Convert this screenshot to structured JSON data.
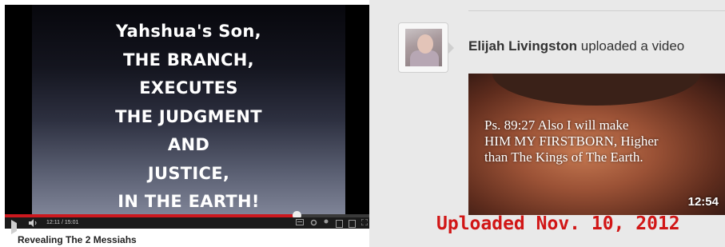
{
  "player": {
    "slide_lines": [
      "Yahshua's Son,",
      "THE BRANCH,",
      "EXECUTES",
      "THE JUDGMENT",
      "AND",
      "JUSTICE,",
      "IN THE EARTH!"
    ],
    "progress_fraction": 0.8,
    "time_display": "12:11 / 15:01",
    "video_title": "Revealing The 2 Messiahs"
  },
  "feed": {
    "user_name": "Elijah Livingston",
    "action_text": " uploaded a video",
    "thumbnail_quote_lines": [
      "Ps. 89:27 Also I will make",
      "HIM MY FIRSTBORN, Higher",
      "than The Kings of The Earth."
    ],
    "duration": "12:54",
    "upload_note": "Uploaded Nov. 10, 2012"
  },
  "colors": {
    "progress_red": "#cc181e",
    "upload_note_red": "#d11616"
  }
}
